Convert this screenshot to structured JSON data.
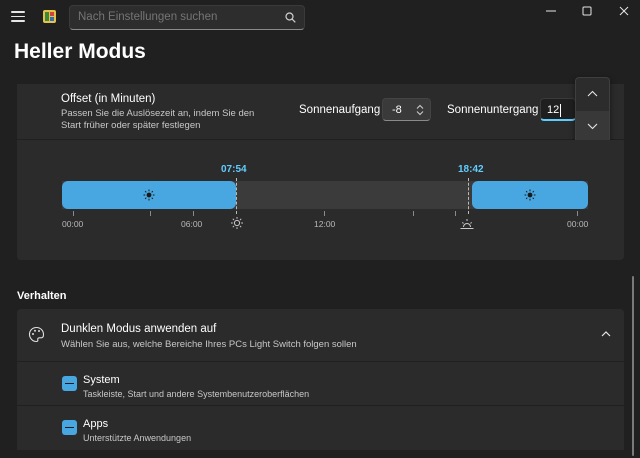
{
  "search": {
    "placeholder": "Nach Einstellungen suchen"
  },
  "page": {
    "title": "Heller Modus"
  },
  "offset": {
    "title": "Offset (in Minuten)",
    "description": "Passen Sie die Auslösezeit an, indem Sie den Start früher oder später festlegen",
    "sunrise_label": "Sonnenaufgang",
    "sunrise_value": "-8",
    "sunset_label": "Sonnenuntergang",
    "sunset_value": "12"
  },
  "timeline": {
    "start_time": "07:54",
    "end_time": "18:42",
    "ticks": [
      "00:00",
      "06:00",
      "12:00",
      "00:00"
    ],
    "light_fraction_start": 0.3292,
    "light_fraction_end": 0.7792
  },
  "behavior": {
    "section_title": "Verhalten",
    "expander_title": "Dunklen Modus anwenden auf",
    "expander_description": "Wählen Sie aus, welche Bereiche Ihres PCs Light Switch folgen sollen",
    "items": [
      {
        "title": "System",
        "description": "Taskleiste, Start und andere Systembenutzeroberflächen",
        "state": "indeterminate"
      },
      {
        "title": "Apps",
        "description": "Unterstützte Anwendungen",
        "state": "indeterminate"
      }
    ]
  },
  "colors": {
    "accent": "#48a6e0",
    "accent_text": "#60cdff",
    "background": "#202020",
    "card": "#2b2b2b"
  },
  "icons": {
    "menu": "hamburger-icon",
    "search": "search-icon",
    "sun": "sun-icon",
    "sunrise": "sunrise-icon",
    "sunset": "sunset-icon",
    "palette": "palette-icon"
  }
}
